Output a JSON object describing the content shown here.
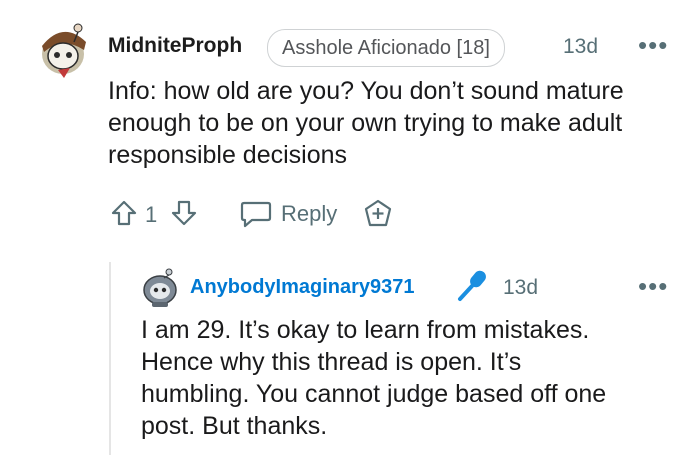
{
  "comment": {
    "username": "MidniteProph",
    "flair": "Asshole Aficionado [18]",
    "timestamp": "13d",
    "more_glyph": "•••",
    "body_lines": [
      "Info: how old are you? You don’t sound mature",
      "enough to be on your own trying to make adult",
      "responsible decisions"
    ],
    "score": "1",
    "reply_label": "Reply",
    "icons": [
      "upvote-icon",
      "downvote-icon",
      "reply-bubble-icon",
      "award-icon"
    ]
  },
  "reply": {
    "username": "AnybodyImaginary9371",
    "badge_icon": "microphone-icon",
    "timestamp": "13d",
    "more_glyph": "•••",
    "body_lines": [
      "I am 29. It’s okay to learn from mistakes.",
      "Hence why this thread is open. It’s",
      "humbling. You cannot judge based off one",
      "post. But thanks."
    ]
  },
  "colors": {
    "reply_username": "#0079d3",
    "mic_badge": "#1b8fe0",
    "meta_gray": "#576f76"
  }
}
